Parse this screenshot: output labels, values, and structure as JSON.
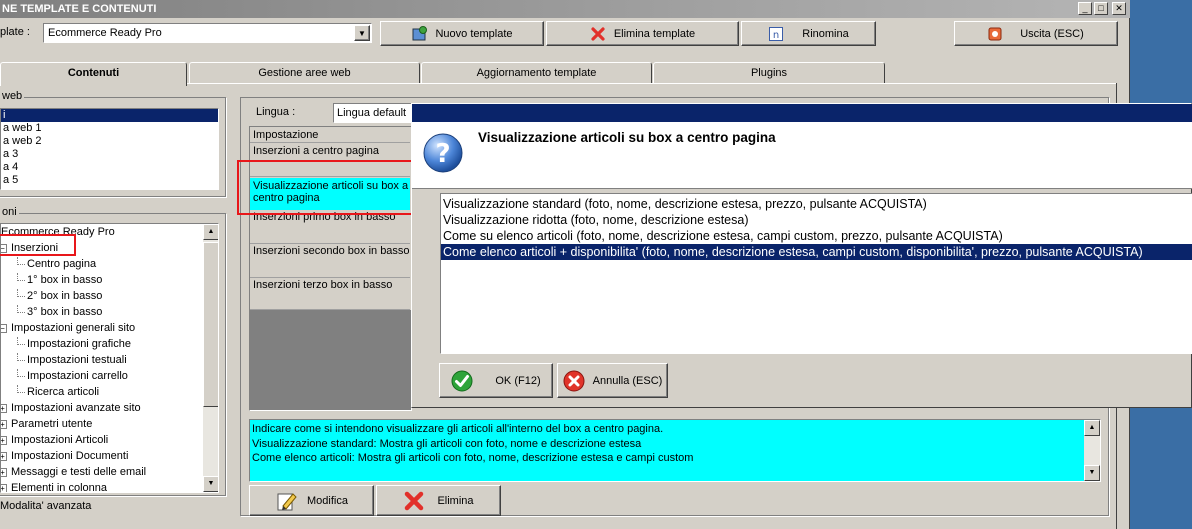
{
  "window": {
    "title": "NE TEMPLATE E CONTENUTI"
  },
  "toolbar": {
    "template_label": "plate :",
    "template_value": "Ecommerce Ready Pro",
    "new_template": "Nuovo template",
    "delete_template": "Elimina template",
    "rename": "Rinomina",
    "exit": "Uscita (ESC)"
  },
  "tabs": [
    "Contenuti",
    "Gestione aree web",
    "Aggiornamento template",
    "Plugins"
  ],
  "web_areas": {
    "label": "web",
    "items": [
      "i",
      "a web 1",
      "a web 2",
      "a 3",
      "a 4",
      "a 5"
    ]
  },
  "sections": {
    "label": "oni",
    "tree": [
      {
        "label": "Ecommerce Ready Pro",
        "level": 0
      },
      {
        "label": "Inserzioni",
        "level": 1,
        "toggle": "−"
      },
      {
        "label": "Centro pagina",
        "level": 2
      },
      {
        "label": "1° box in basso",
        "level": 2
      },
      {
        "label": "2° box in basso",
        "level": 2
      },
      {
        "label": "3° box in basso",
        "level": 2
      },
      {
        "label": "Impostazioni generali sito",
        "level": 1,
        "toggle": "−"
      },
      {
        "label": "Impostazioni grafiche",
        "level": 2
      },
      {
        "label": "Impostazioni testuali",
        "level": 2
      },
      {
        "label": "Impostazioni carrello",
        "level": 2
      },
      {
        "label": "Ricerca articoli",
        "level": 2
      },
      {
        "label": "Impostazioni avanzate sito",
        "level": 1,
        "toggle": "+"
      },
      {
        "label": "Parametri utente",
        "level": 1,
        "toggle": "+"
      },
      {
        "label": "Impostazioni Articoli",
        "level": 1,
        "toggle": "+"
      },
      {
        "label": "Impostazioni Documenti",
        "level": 1,
        "toggle": "+"
      },
      {
        "label": "Messaggi e testi delle email",
        "level": 1,
        "toggle": "+"
      },
      {
        "label": "Elementi in colonna",
        "level": 1,
        "toggle": "+"
      }
    ],
    "advanced_mode": "Modalita' avanzata"
  },
  "content": {
    "language_label": "Lingua :",
    "language_value": "Lingua default",
    "grid_header": "Impostazione",
    "rows": [
      "Inserzioni a centro pagina",
      "Visualizzazione articoli su box a centro pagina",
      "Inserzioni primo box in basso",
      "Inserzioni secondo box in basso",
      "Inserzioni terzo box in basso"
    ],
    "description": [
      "Indicare come si intendono visualizzare gli articoli all'interno del box a centro pagina.",
      "Visualizzazione standard: Mostra gli articoli con foto, nome e descrizione estesa",
      "Come elenco articoli: Mostra gli articoli con foto, nome, descrizione estesa e campi custom"
    ],
    "modify": "Modifica",
    "delete": "Elimina"
  },
  "dialog": {
    "title": "Visualizzazione articoli su box a centro pagina",
    "options": [
      "Visualizzazione standard (foto, nome, descrizione estesa, prezzo, pulsante ACQUISTA)",
      "Visualizzazione ridotta (foto, nome, descrizione estesa)",
      "Come su elenco articoli (foto, nome, descrizione estesa, campi custom, prezzo, pulsante ACQUISTA)",
      "Come elenco articoli + disponibilita' (foto, nome, descrizione estesa, campi custom, disponibilita', prezzo, pulsante ACQUISTA)"
    ],
    "selected_index": 3,
    "ok": "OK (F12)",
    "cancel": "Annulla (ESC)"
  },
  "colors": {
    "selection": "#0a246a",
    "highlight": "#00ffff",
    "annotation": "#e8161a"
  }
}
